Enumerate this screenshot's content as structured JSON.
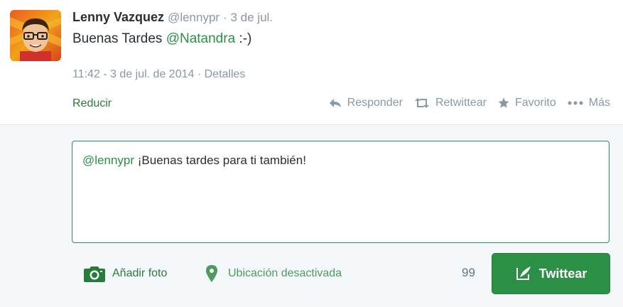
{
  "tweet": {
    "author_name": "Lenny Vazquez",
    "author_handle": "@lennypr",
    "date_short": "· 3 de jul.",
    "text_before": "Buenas Tardes",
    "mention": "@Natandra",
    "text_after": ":-)",
    "timestamp": "11:42 - 3 de jul. de 2014 · Detalles",
    "collapse_label": "Reducir",
    "actions": {
      "reply": "Responder",
      "retweet": "Retwittear",
      "favorite": "Favorito",
      "more": "Más"
    }
  },
  "composer": {
    "mention": "@lennypr",
    "text": "¡Buenas tardes para ti también!",
    "add_photo_label": "Añadir foto",
    "location_label": "Ubicación desactivada",
    "char_count": "99",
    "submit_label": "Twittear"
  },
  "colors": {
    "accent": "#2b9046",
    "muted": "#8899a6"
  }
}
